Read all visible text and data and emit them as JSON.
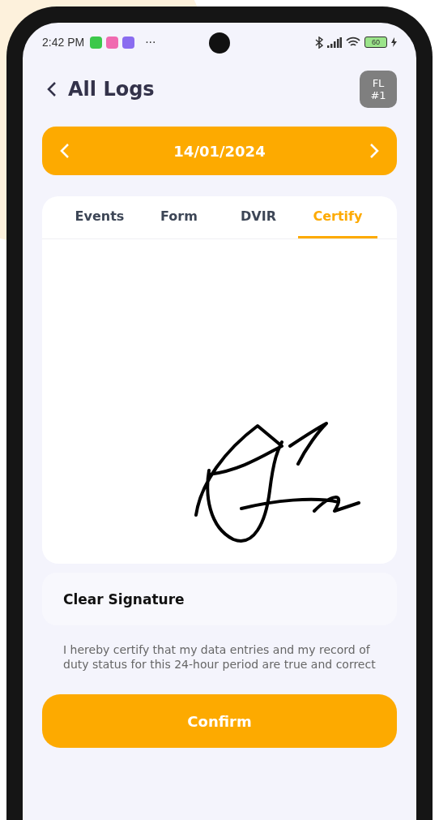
{
  "status_bar": {
    "time": "2:42 PM",
    "more": "···",
    "battery": "60",
    "app_icons": [
      {
        "color": "#3cc84a"
      },
      {
        "color": "#f06ab0"
      },
      {
        "color": "#8a6cf0"
      }
    ]
  },
  "header": {
    "title": "All Logs",
    "badge_line_1": "FL",
    "badge_line_2": "#1"
  },
  "date_bar": {
    "date": "14/01/2024"
  },
  "tabs": [
    {
      "label": "Events",
      "selected": false
    },
    {
      "label": "Form",
      "selected": false
    },
    {
      "label": "DVIR",
      "selected": false
    },
    {
      "label": "Certify",
      "selected": true
    }
  ],
  "clear_button": "Clear Signature",
  "certification_text": "I hereby certify that my data entries and my record of duty status for this 24-hour period are true and correct",
  "confirm_button": "Confirm"
}
